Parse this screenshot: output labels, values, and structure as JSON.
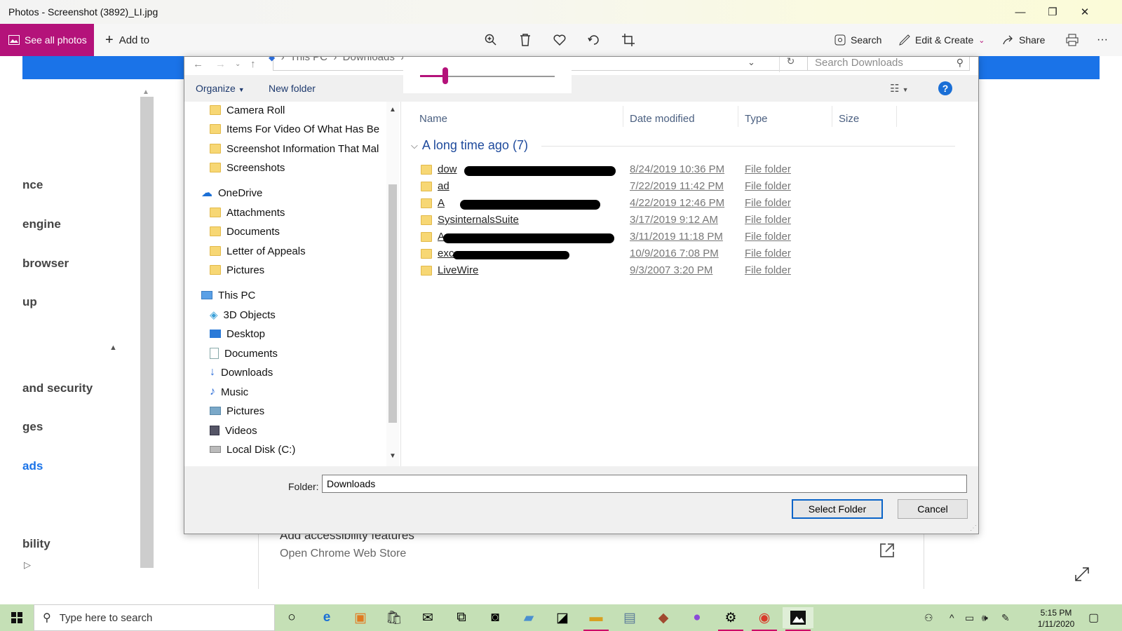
{
  "window": {
    "title": "Photos - Screenshot (3892)_LI.jpg",
    "minimize": "—",
    "restore": "❐",
    "close": "✕"
  },
  "photos_toolbar": {
    "see_all": "See all photos",
    "add_to": "Add to",
    "search": "Search",
    "edit_create": "Edit & Create",
    "share": "Share",
    "more": "···",
    "accent": "#b4127a"
  },
  "background": {
    "menu": [
      "nce",
      "engine",
      "browser",
      "up",
      "and security",
      "ges",
      "ads",
      "bility"
    ],
    "card_title": "Add accessibility features",
    "card_sub": "Open Chrome Web Store"
  },
  "dialog": {
    "breadcrumb": [
      "This PC",
      "Downloads"
    ],
    "search_placeholder": "Search Downloads",
    "organize": "Organize",
    "new_folder": "New folder",
    "help": "?",
    "tree": [
      {
        "label": "Camera Roll",
        "icon": "folder-icon"
      },
      {
        "label": "Items For Video Of What Has Be",
        "icon": "folder-icon"
      },
      {
        "label": "Screenshot Information That Mal",
        "icon": "folder-icon"
      },
      {
        "label": "Screenshots",
        "icon": "folder-icon"
      },
      {
        "label": "OneDrive",
        "icon": "onedrive-icon"
      },
      {
        "label": "Attachments",
        "icon": "folder-icon"
      },
      {
        "label": "Documents",
        "icon": "folder-icon"
      },
      {
        "label": "Letter of Appeals",
        "icon": "folder-icon"
      },
      {
        "label": "Pictures",
        "icon": "folder-icon"
      },
      {
        "label": "This PC",
        "icon": "computer-icon"
      },
      {
        "label": "3D Objects",
        "icon": "3d-objects-icon"
      },
      {
        "label": "Desktop",
        "icon": "desktop-icon"
      },
      {
        "label": "Documents",
        "icon": "documents-icon"
      },
      {
        "label": "Downloads",
        "icon": "downloads-icon"
      },
      {
        "label": "Music",
        "icon": "music-icon"
      },
      {
        "label": "Pictures",
        "icon": "pictures-icon"
      },
      {
        "label": "Videos",
        "icon": "videos-icon"
      },
      {
        "label": "Local Disk (C:)",
        "icon": "disk-icon"
      }
    ],
    "columns": [
      "Name",
      "Date modified",
      "Type",
      "Size"
    ],
    "group_label": "A long time ago (7)",
    "files": [
      {
        "name": "dow",
        "date": "8/24/2019 10:36 PM",
        "type": "File folder"
      },
      {
        "name": "ad",
        "date": "7/22/2019 11:42 PM",
        "type": "File folder"
      },
      {
        "name": "A",
        "date": "4/22/2019 12:46 PM",
        "type": "File folder"
      },
      {
        "name": "SysinternalsSuite",
        "date": "3/17/2019 9:12 AM",
        "type": "File folder"
      },
      {
        "name": "A",
        "date": "3/11/2019 11:18 PM",
        "type": "File folder"
      },
      {
        "name": "exc",
        "date": "10/9/2016 7:08 PM",
        "type": "File folder"
      },
      {
        "name": "LiveWire",
        "date": "9/3/2007 3:20 PM",
        "type": "File folder"
      }
    ],
    "folder_label": "Folder:",
    "folder_value": "Downloads",
    "select_folder": "Select Folder",
    "cancel": "Cancel"
  },
  "taskbar": {
    "search_placeholder": "Type here to search",
    "time": "5:15 PM",
    "date": "1/11/2020",
    "background": "#c5e0b6"
  }
}
